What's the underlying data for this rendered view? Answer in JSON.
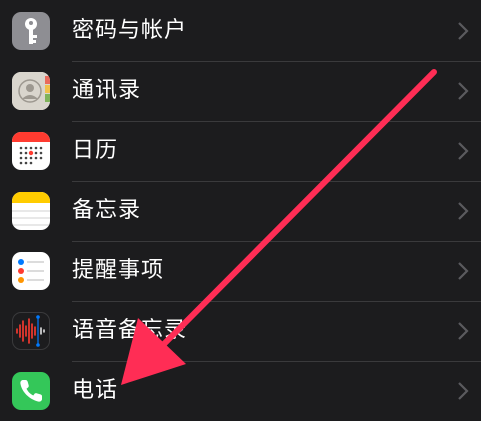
{
  "settings_list": {
    "items": [
      {
        "label": "密码与帐户",
        "icon": "key-icon"
      },
      {
        "label": "通讯录",
        "icon": "contacts-icon"
      },
      {
        "label": "日历",
        "icon": "calendar-icon"
      },
      {
        "label": "备忘录",
        "icon": "notes-icon"
      },
      {
        "label": "提醒事项",
        "icon": "reminders-icon"
      },
      {
        "label": "语音备忘录",
        "icon": "voice-memos-icon"
      },
      {
        "label": "电话",
        "icon": "phone-icon"
      }
    ]
  },
  "colors": {
    "background": "#1c1c1e",
    "separator": "#3a3a3c",
    "arrow": "#ff2d55",
    "phone_green": "#34c759"
  }
}
